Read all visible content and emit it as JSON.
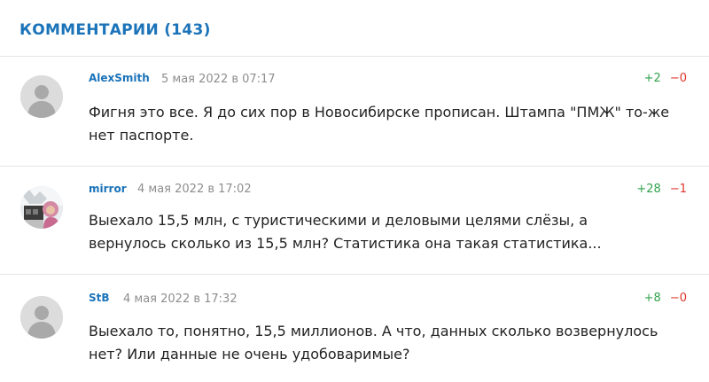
{
  "comments_section": {
    "title": "КОММЕНТАРИИ (143)",
    "comments": [
      {
        "author": "AlexSmith",
        "date": "5 мая 2022 в 07:17",
        "votes_up": "+2",
        "votes_down": "−0",
        "avatar": "default-user-icon",
        "lines": [
          "Фигня это все. Я до сих пор в Новосибирске прописан. Штампа \"ПМЖ\" то-же",
          "нет паспорте."
        ]
      },
      {
        "author": "mirror",
        "date": "4 мая 2022 в 17:02",
        "votes_up": "+28",
        "votes_down": "−1",
        "avatar": "user-photo",
        "lines": [
          "Выехало 15,5 млн, с туристическими и деловыми целями слёзы, а",
          "вернулось сколько из 15,5 млн? Статистика она такая статистика..."
        ]
      },
      {
        "author": "StB",
        "date": "4 мая 2022 в 17:32",
        "votes_up": "+8",
        "votes_down": "−0",
        "avatar": "default-user-icon",
        "lines": [
          "Выехало то, понятно, 15,5 миллионов. А что, данных сколько возвернулось",
          "нет? Или данные не очень удобоваримые?"
        ]
      }
    ]
  },
  "colors": {
    "accent": "#1b73b9",
    "vote_up": "#31a24c",
    "vote_down": "#e0352b",
    "date": "#8e8e8e",
    "divider": "#e6e6e6"
  }
}
